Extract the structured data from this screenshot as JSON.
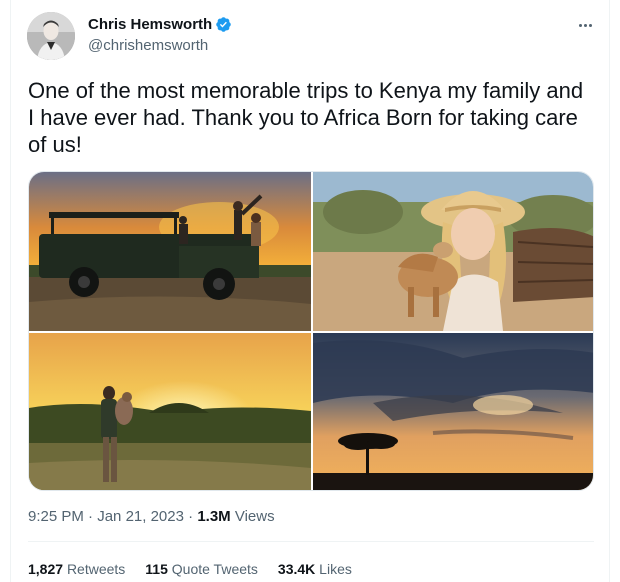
{
  "author": {
    "name": "Chris Hemsworth",
    "handle": "@chrishemsworth",
    "verified": true
  },
  "tweet": {
    "text": "One of the most memorable trips to Kenya my family and I have ever had. Thank you to Africa Born for taking care of us!"
  },
  "meta": {
    "time": "9:25 PM",
    "separator": " · ",
    "date": "Jan 21, 2023",
    "views_count": "1.3M",
    "views_label": "Views"
  },
  "stats": {
    "retweets_count": "1,827",
    "retweets_label": "Retweets",
    "quotes_count": "115",
    "quotes_label": "Quote Tweets",
    "likes_count": "33.4K",
    "likes_label": "Likes"
  },
  "colors": {
    "verified": "#1d9bf0",
    "text_primary": "#0f1419",
    "text_secondary": "#536471"
  }
}
